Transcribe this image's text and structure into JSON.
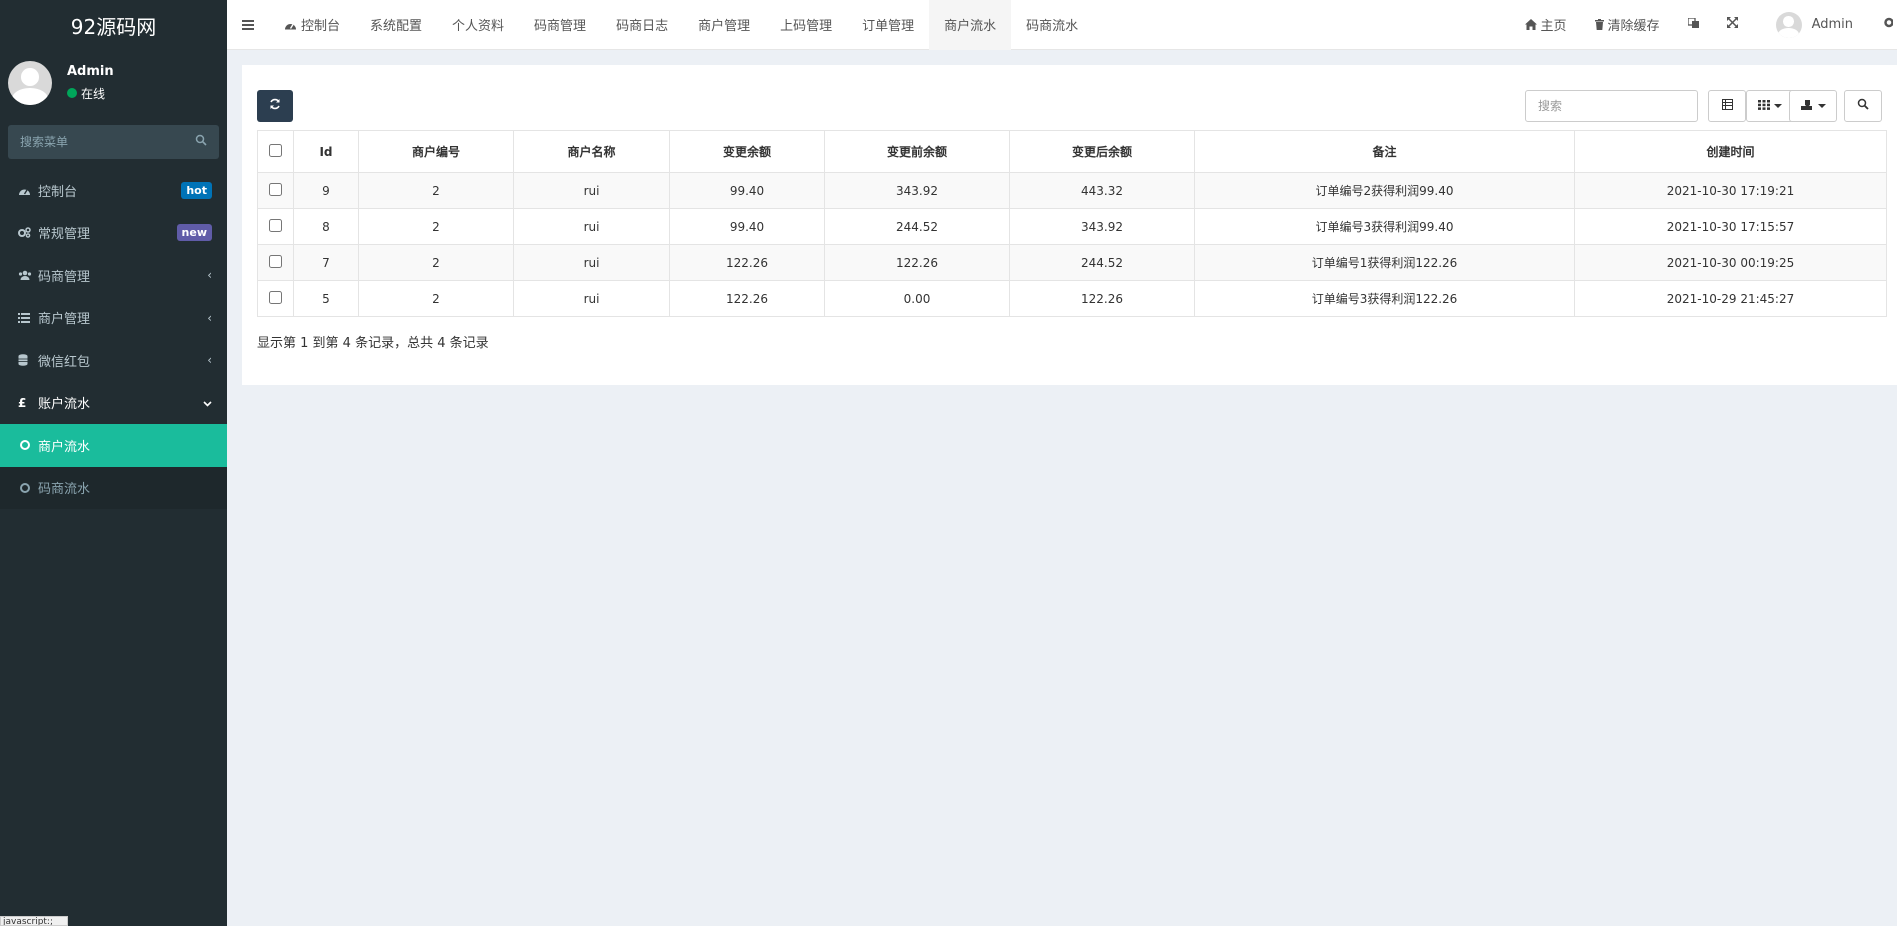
{
  "app": {
    "title": "92源码网"
  },
  "user": {
    "name": "Admin",
    "status": "在线"
  },
  "sidebar": {
    "search_placeholder": "搜索菜单",
    "items": [
      {
        "label": "控制台",
        "icon": "dashboard-icon",
        "badge": "hot"
      },
      {
        "label": "常规管理",
        "icon": "cogs-icon",
        "badge": "new"
      },
      {
        "label": "码商管理",
        "icon": "users-icon"
      },
      {
        "label": "商户管理",
        "icon": "list-icon"
      },
      {
        "label": "微信红包",
        "icon": "database-icon"
      },
      {
        "label": "账户流水",
        "icon": "pound-icon"
      }
    ],
    "sub_items": [
      {
        "label": "商户流水"
      },
      {
        "label": "码商流水"
      }
    ]
  },
  "topbar": {
    "tabs": [
      {
        "label": "控制台"
      },
      {
        "label": "系统配置"
      },
      {
        "label": "个人资料"
      },
      {
        "label": "码商管理"
      },
      {
        "label": "码商日志"
      },
      {
        "label": "商户管理"
      },
      {
        "label": "上码管理"
      },
      {
        "label": "订单管理"
      },
      {
        "label": "商户流水"
      },
      {
        "label": "码商流水"
      }
    ],
    "home_label": "主页",
    "clear_cache_label": "清除缓存",
    "user_label": "Admin"
  },
  "table": {
    "search_placeholder": "搜索",
    "columns": [
      "Id",
      "商户编号",
      "商户名称",
      "变更余额",
      "变更前余额",
      "变更后余额",
      "备注",
      "创建时间"
    ],
    "rows": [
      [
        "9",
        "2",
        "rui",
        "99.40",
        "343.92",
        "443.32",
        "订单编号2获得利润99.40",
        "2021-10-30 17:19:21"
      ],
      [
        "8",
        "2",
        "rui",
        "99.40",
        "244.52",
        "343.92",
        "订单编号3获得利润99.40",
        "2021-10-30 17:15:57"
      ],
      [
        "7",
        "2",
        "rui",
        "122.26",
        "122.26",
        "244.52",
        "订单编号1获得利润122.26",
        "2021-10-30 00:19:25"
      ],
      [
        "5",
        "2",
        "rui",
        "122.26",
        "0.00",
        "122.26",
        "订单编号3获得利润122.26",
        "2021-10-29 21:45:27"
      ]
    ],
    "pagination_info": "显示第 1 到第 4 条记录，总共 4 条记录"
  },
  "status_tip": "javascript:;",
  "colors": {
    "sidebar_bg": "#222d32",
    "active_green": "#1abc9c",
    "badge_hot": "#0073b7",
    "badge_new": "#605ca8",
    "refresh_btn": "#2c3e50"
  }
}
